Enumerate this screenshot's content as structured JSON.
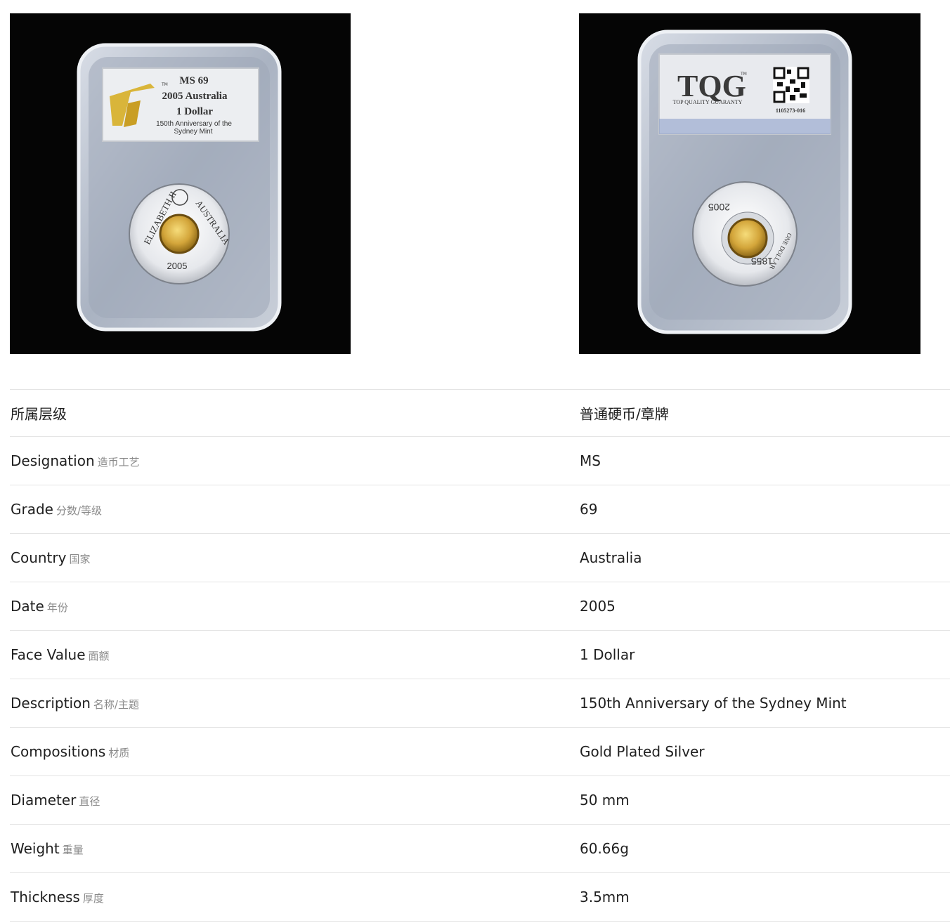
{
  "front_slab": {
    "grade": "MS 69",
    "year_country": "2005 Australia",
    "denomination": "1 Dollar",
    "description_line1": "150th Anniversary of the",
    "description_line2": "Sydney Mint",
    "tm": "TM",
    "coin_text_left": "ELIZABETH II",
    "coin_text_right": "AUSTRALIA",
    "coin_year": "2005"
  },
  "back_slab": {
    "logo": "TQG",
    "tm": "TM",
    "tagline": "TOP QUALITY GUARANTY",
    "cert_number": "1105273-016",
    "coin_text_top": "2005",
    "coin_text_side": "ONE DOLLAR",
    "coin_text_bottom": "1855"
  },
  "specs": [
    {
      "label": "所属层级",
      "label_zh": "",
      "value": "普通硬币/章牌"
    },
    {
      "label": "Designation",
      "label_zh": "造币工艺",
      "value": "MS"
    },
    {
      "label": "Grade",
      "label_zh": "分数/等级",
      "value": "69"
    },
    {
      "label": "Country",
      "label_zh": "国家",
      "value": "Australia"
    },
    {
      "label": "Date",
      "label_zh": "年份",
      "value": "2005"
    },
    {
      "label": "Face Value",
      "label_zh": "面额",
      "value": "1 Dollar"
    },
    {
      "label": "Description",
      "label_zh": "名称/主题",
      "value": "150th Anniversary of the Sydney Mint"
    },
    {
      "label": "Compositions",
      "label_zh": "材质",
      "value": "Gold Plated Silver"
    },
    {
      "label": "Diameter",
      "label_zh": "直径",
      "value": "50 mm"
    },
    {
      "label": "Weight",
      "label_zh": "重量",
      "value": "60.66g"
    },
    {
      "label": "Thickness",
      "label_zh": "厚度",
      "value": "3.5mm"
    }
  ]
}
